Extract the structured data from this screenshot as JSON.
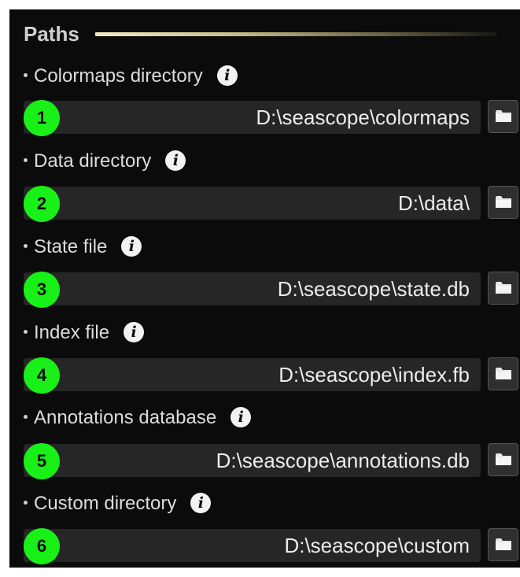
{
  "section": {
    "title": "Paths"
  },
  "fields": [
    {
      "badge": "1",
      "label": "Colormaps directory",
      "value": "D:\\seascope\\colormaps"
    },
    {
      "badge": "2",
      "label": "Data directory",
      "value": "D:\\data\\"
    },
    {
      "badge": "3",
      "label": "State file",
      "value": "D:\\seascope\\state.db"
    },
    {
      "badge": "4",
      "label": "Index file",
      "value": "D:\\seascope\\index.fb"
    },
    {
      "badge": "5",
      "label": "Annotations database",
      "value": "D:\\seascope\\annotations.db"
    },
    {
      "badge": "6",
      "label": "Custom directory",
      "value": "D:\\seascope\\custom"
    }
  ],
  "icons": {
    "info": "info-icon",
    "browse": "folder-icon"
  },
  "colors": {
    "badge": "#18f018",
    "background": "#0b0b0b",
    "field": "#262626"
  }
}
